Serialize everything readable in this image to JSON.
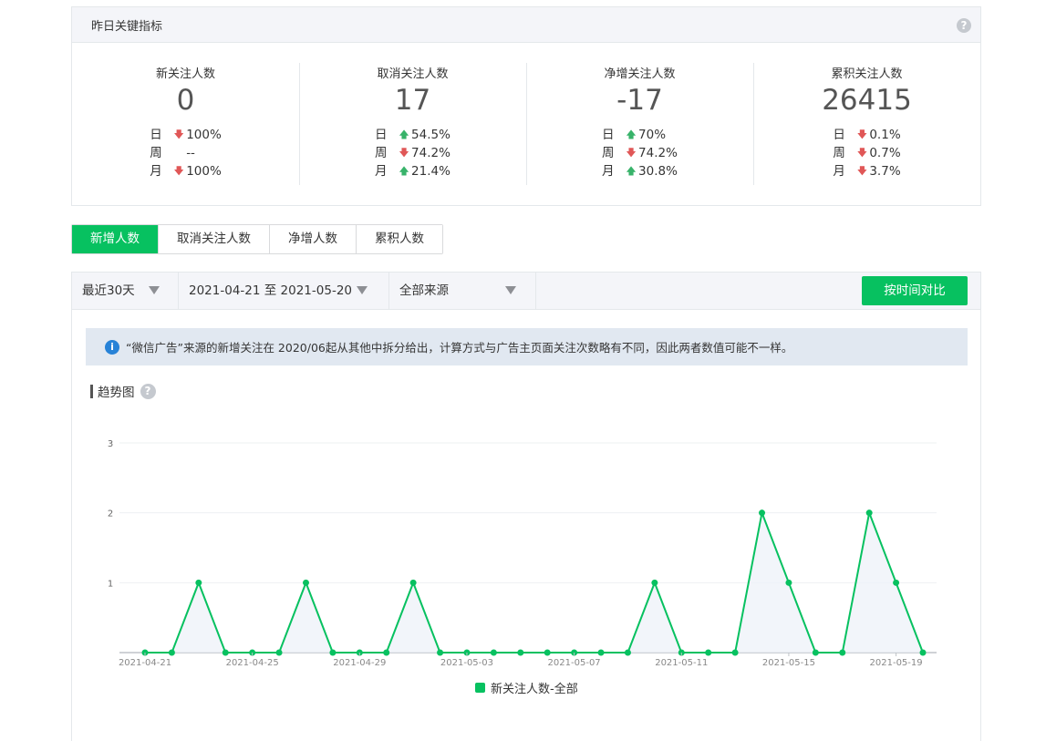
{
  "panel": {
    "title": "昨日关键指标"
  },
  "metrics": [
    {
      "title": "新关注人数",
      "value": "0",
      "rows": [
        {
          "label": "日",
          "dir": "down",
          "value": "100%"
        },
        {
          "label": "周",
          "dir": "none",
          "value": "--"
        },
        {
          "label": "月",
          "dir": "down",
          "value": "100%"
        }
      ]
    },
    {
      "title": "取消关注人数",
      "value": "17",
      "rows": [
        {
          "label": "日",
          "dir": "up",
          "value": "54.5%"
        },
        {
          "label": "周",
          "dir": "down",
          "value": "74.2%"
        },
        {
          "label": "月",
          "dir": "up",
          "value": "21.4%"
        }
      ]
    },
    {
      "title": "净增关注人数",
      "value": "-17",
      "rows": [
        {
          "label": "日",
          "dir": "up",
          "value": "70%"
        },
        {
          "label": "周",
          "dir": "down",
          "value": "74.2%"
        },
        {
          "label": "月",
          "dir": "up",
          "value": "30.8%"
        }
      ]
    },
    {
      "title": "累积关注人数",
      "value": "26415",
      "rows": [
        {
          "label": "日",
          "dir": "down",
          "value": "0.1%"
        },
        {
          "label": "周",
          "dir": "down",
          "value": "0.7%"
        },
        {
          "label": "月",
          "dir": "down",
          "value": "3.7%"
        }
      ]
    }
  ],
  "tabs": [
    "新增人数",
    "取消关注人数",
    "净增人数",
    "累积人数"
  ],
  "filters": {
    "range": "最近30天",
    "dates": "2021-04-21 至 2021-05-20",
    "source": "全部来源",
    "compare_button": "按时间对比"
  },
  "notice": "“微信广告”来源的新增关注在 2020/06起从其他中拆分给出，计算方式与广告主页面关注次数略有不同，因此两者数值可能不一样。",
  "trend_title": "趋势图",
  "colors": {
    "accent": "#07c160",
    "down": "#e05757",
    "up": "#38b36a"
  },
  "chart_data": {
    "type": "line",
    "x": [
      "2021-04-21",
      "2021-04-22",
      "2021-04-23",
      "2021-04-24",
      "2021-04-25",
      "2021-04-26",
      "2021-04-27",
      "2021-04-28",
      "2021-04-29",
      "2021-04-30",
      "2021-05-01",
      "2021-05-02",
      "2021-05-03",
      "2021-05-04",
      "2021-05-05",
      "2021-05-06",
      "2021-05-07",
      "2021-05-08",
      "2021-05-09",
      "2021-05-10",
      "2021-05-11",
      "2021-05-12",
      "2021-05-13",
      "2021-05-14",
      "2021-05-15",
      "2021-05-16",
      "2021-05-17",
      "2021-05-18",
      "2021-05-19",
      "2021-05-20"
    ],
    "x_tick_labels": [
      "2021-04-21",
      "2021-04-25",
      "2021-04-29",
      "2021-05-03",
      "2021-05-07",
      "2021-05-11",
      "2021-05-15",
      "2021-05-19"
    ],
    "y_ticks": [
      "1",
      "2",
      "3"
    ],
    "ylim": [
      0,
      3
    ],
    "series": [
      {
        "name": "新关注人数-全部",
        "values": [
          0,
          0,
          1,
          0,
          0,
          0,
          1,
          0,
          0,
          0,
          1,
          0,
          0,
          0,
          0,
          0,
          0,
          0,
          0,
          1,
          0,
          0,
          0,
          2,
          1,
          0,
          0,
          2,
          1,
          0
        ]
      }
    ],
    "legend": "bottom",
    "grid": true
  }
}
